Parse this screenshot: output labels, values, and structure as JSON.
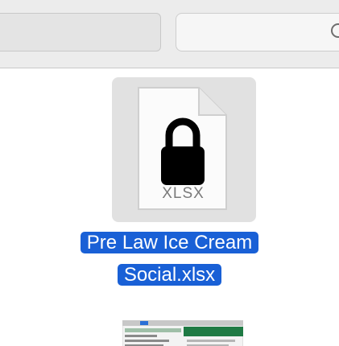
{
  "window": {
    "search": {
      "placeholder": ""
    }
  },
  "selected_file": {
    "name_line1": "Pre Law Ice Cream",
    "name_line2": "Social.xlsx",
    "type_label": "XLSX",
    "locked": true,
    "selected": true
  },
  "next_file": {
    "thumbnail": "spreadsheet-preview"
  },
  "colors": {
    "selection": "#1960d6",
    "toolbar": "#ececec",
    "thumb_background": "#e1e1e1",
    "lock": "#000000",
    "spreadsheet_green": "#1f7a44"
  },
  "icons": {
    "search": "search-icon",
    "lock": "lock-icon",
    "document": "document-icon"
  }
}
